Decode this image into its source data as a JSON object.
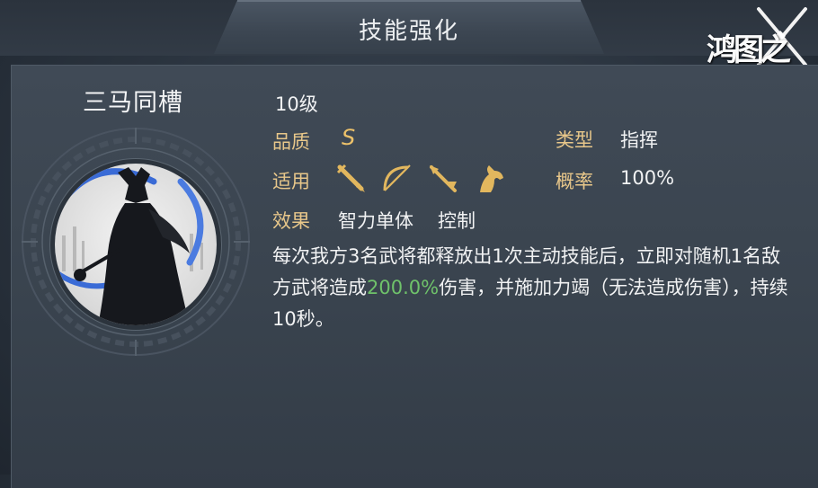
{
  "header": {
    "title": "技能强化",
    "logo_text": "鸿图之下"
  },
  "skill": {
    "name": "三马同槽",
    "level": "10级",
    "quality_label": "品质",
    "quality_value": "S",
    "type_label": "类型",
    "type_value": "指挥",
    "applicable_label": "适用",
    "applicable_icons": [
      "spear-icon",
      "bow-icon",
      "halberd-icon",
      "horse-icon"
    ],
    "rate_label": "概率",
    "rate_value": "100%",
    "effect_label": "效果",
    "effect_value_1": "智力单体",
    "effect_value_2": "控制",
    "description_part1": "每次我方3名武将都释放出1次主动技能后，立即对随机1名敌方武将造成",
    "description_highlight": "200.0%",
    "description_part2": "伤害，并施加力竭（无法造成伤害），持续10秒。"
  },
  "colors": {
    "label_gold": "#e8c78a",
    "highlight_green": "#6fc26a",
    "grade_gold": "#ecc16a"
  }
}
